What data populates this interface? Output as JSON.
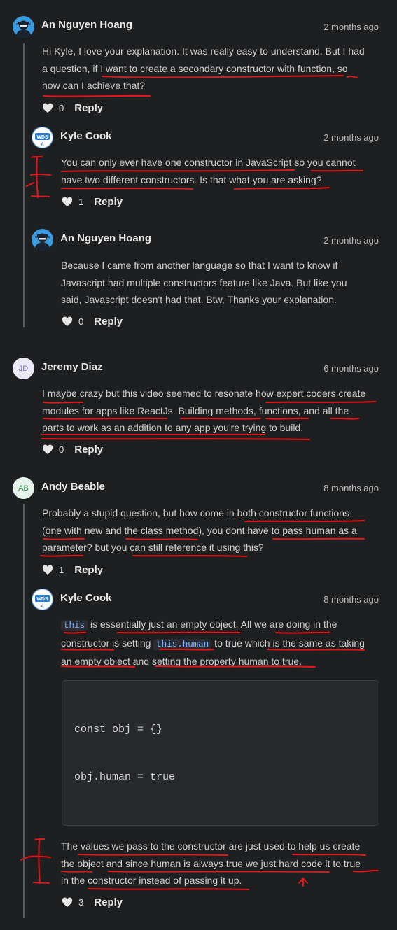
{
  "heart_icon": "heart-outline-icon",
  "reply_label": "Reply",
  "comments": [
    {
      "author": "An Nguyen Hoang",
      "time": "2 months ago",
      "lines": [
        "Hi Kyle, I love your explanation. It was really easy to understand. But I had",
        "a question, if I want to create a secondary constructor with function, so",
        "how can I achieve that?"
      ],
      "likes": "0",
      "replies": [
        {
          "author": "Kyle Cook",
          "avatar_text": "WDS",
          "time": "2 months ago",
          "lines": [
            "You can only ever have one constructor in JavaScript so you cannot",
            "have two different constructors. Is that what you are asking?"
          ],
          "likes": "1"
        },
        {
          "author": "An Nguyen Hoang",
          "time": "2 months ago",
          "lines": [
            "Because I came from another language so that I want to know if",
            "Javascript had multiple constructors feature like Java. But like you",
            "said, Javascript doesn't had that. Btw, Thanks your explanation."
          ],
          "likes": "0"
        }
      ]
    },
    {
      "author": "Jeremy Diaz",
      "avatar_initials": "JD",
      "time": "6 months ago",
      "lines": [
        "I maybe crazy but this video seemed to resonate how expert coders create",
        "modules for apps like ReactJs. Building methods, functions, and all the",
        "parts to work as an addition to any app you're trying to build."
      ],
      "likes": "0"
    },
    {
      "author": "Andy Beable",
      "avatar_initials": "AB",
      "time": "8 months ago",
      "lines": [
        "Probably a stupid question, but how come in both constructor functions",
        "(one with new and the class method), you dont have to pass human as a",
        "parameter? but you can still reference it using this?"
      ],
      "likes": "1",
      "replies": [
        {
          "author": "Kyle Cook",
          "avatar_text": "WDS",
          "time": "8 months ago",
          "p1_code1": "this",
          "p1_line1": " is essentially just an empty object. All we are doing in the",
          "p1_line2a": "constructor is setting ",
          "p1_code2": "this.human",
          "p1_line2b": " to true which is the same as taking",
          "p1_line3": "an empty object and setting the property human to true.",
          "code": [
            "const obj = {}",
            "obj.human = true"
          ],
          "p2_lines": [
            "The values we pass to the constructor are just used to help us create",
            "the object and since human is always true we just hard code it to true",
            "in the constructor instead of passing it up."
          ],
          "likes": "3"
        }
      ]
    }
  ]
}
